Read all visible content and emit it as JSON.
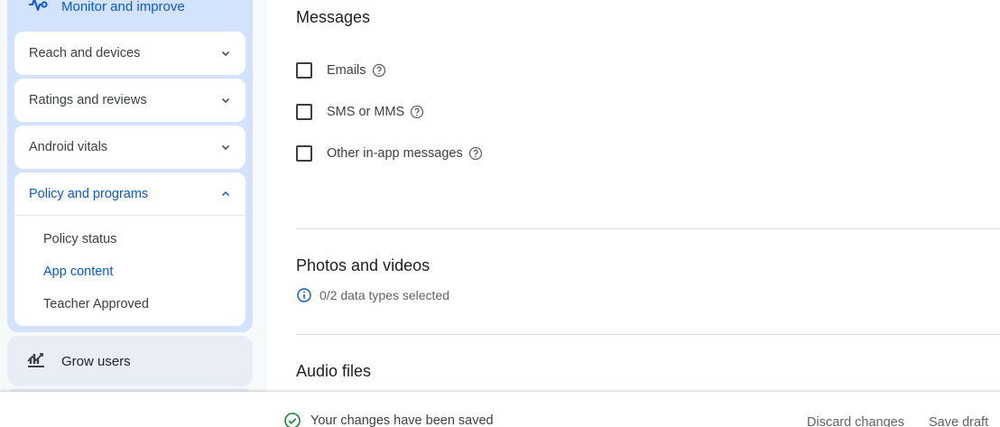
{
  "sidebar": {
    "monitor_label": "Monitor and improve",
    "accordions": [
      {
        "label": "Reach and devices"
      },
      {
        "label": "Ratings and reviews"
      },
      {
        "label": "Android vitals"
      }
    ],
    "policy": {
      "label": "Policy and programs",
      "items": [
        "Policy status",
        "App content",
        "Teacher Approved"
      ],
      "active": "App content"
    },
    "grow_label": "Grow users"
  },
  "main": {
    "messages": {
      "title": "Messages",
      "options": [
        {
          "label": "Emails",
          "checked": false
        },
        {
          "label": "SMS or MMS",
          "checked": false
        },
        {
          "label": "Other in-app messages",
          "checked": false
        }
      ]
    },
    "photos": {
      "title": "Photos and videos",
      "info": "0/2 data types selected"
    },
    "audio": {
      "title": "Audio files"
    }
  },
  "footer": {
    "status": "Your changes have been saved",
    "discard_label": "Discard changes",
    "save_label": "Save draft"
  },
  "colors": {
    "accent": "#0b57d0",
    "section_bg": "#d3e3fd",
    "success": "#188038"
  }
}
